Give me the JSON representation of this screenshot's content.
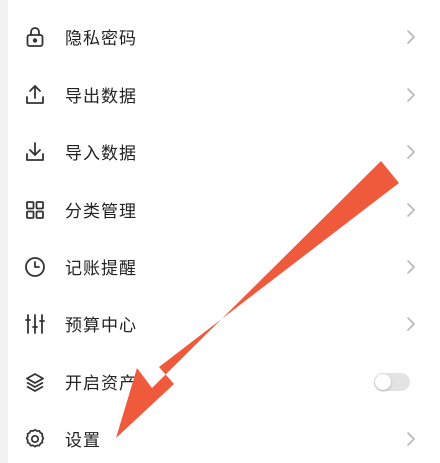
{
  "menu": {
    "items": [
      {
        "label": "隐私密码",
        "icon": "lock-icon",
        "trailing": "chevron"
      },
      {
        "label": "导出数据",
        "icon": "upload-icon",
        "trailing": "chevron"
      },
      {
        "label": "导入数据",
        "icon": "download-icon",
        "trailing": "chevron"
      },
      {
        "label": "分类管理",
        "icon": "grid-icon",
        "trailing": "chevron"
      },
      {
        "label": "记账提醒",
        "icon": "clock-icon",
        "trailing": "chevron"
      },
      {
        "label": "预算中心",
        "icon": "sliders-icon",
        "trailing": "chevron"
      },
      {
        "label": "开启资产",
        "icon": "layers-icon",
        "trailing": "toggle",
        "toggle_on": false
      },
      {
        "label": "设置",
        "icon": "gear-icon",
        "trailing": "chevron"
      }
    ]
  },
  "colors": {
    "arrow": "#f05a3c",
    "label": "#222222",
    "icon": "#333333",
    "chevron": "#b8b8b8",
    "toggle_off": "#e3e3e3"
  }
}
